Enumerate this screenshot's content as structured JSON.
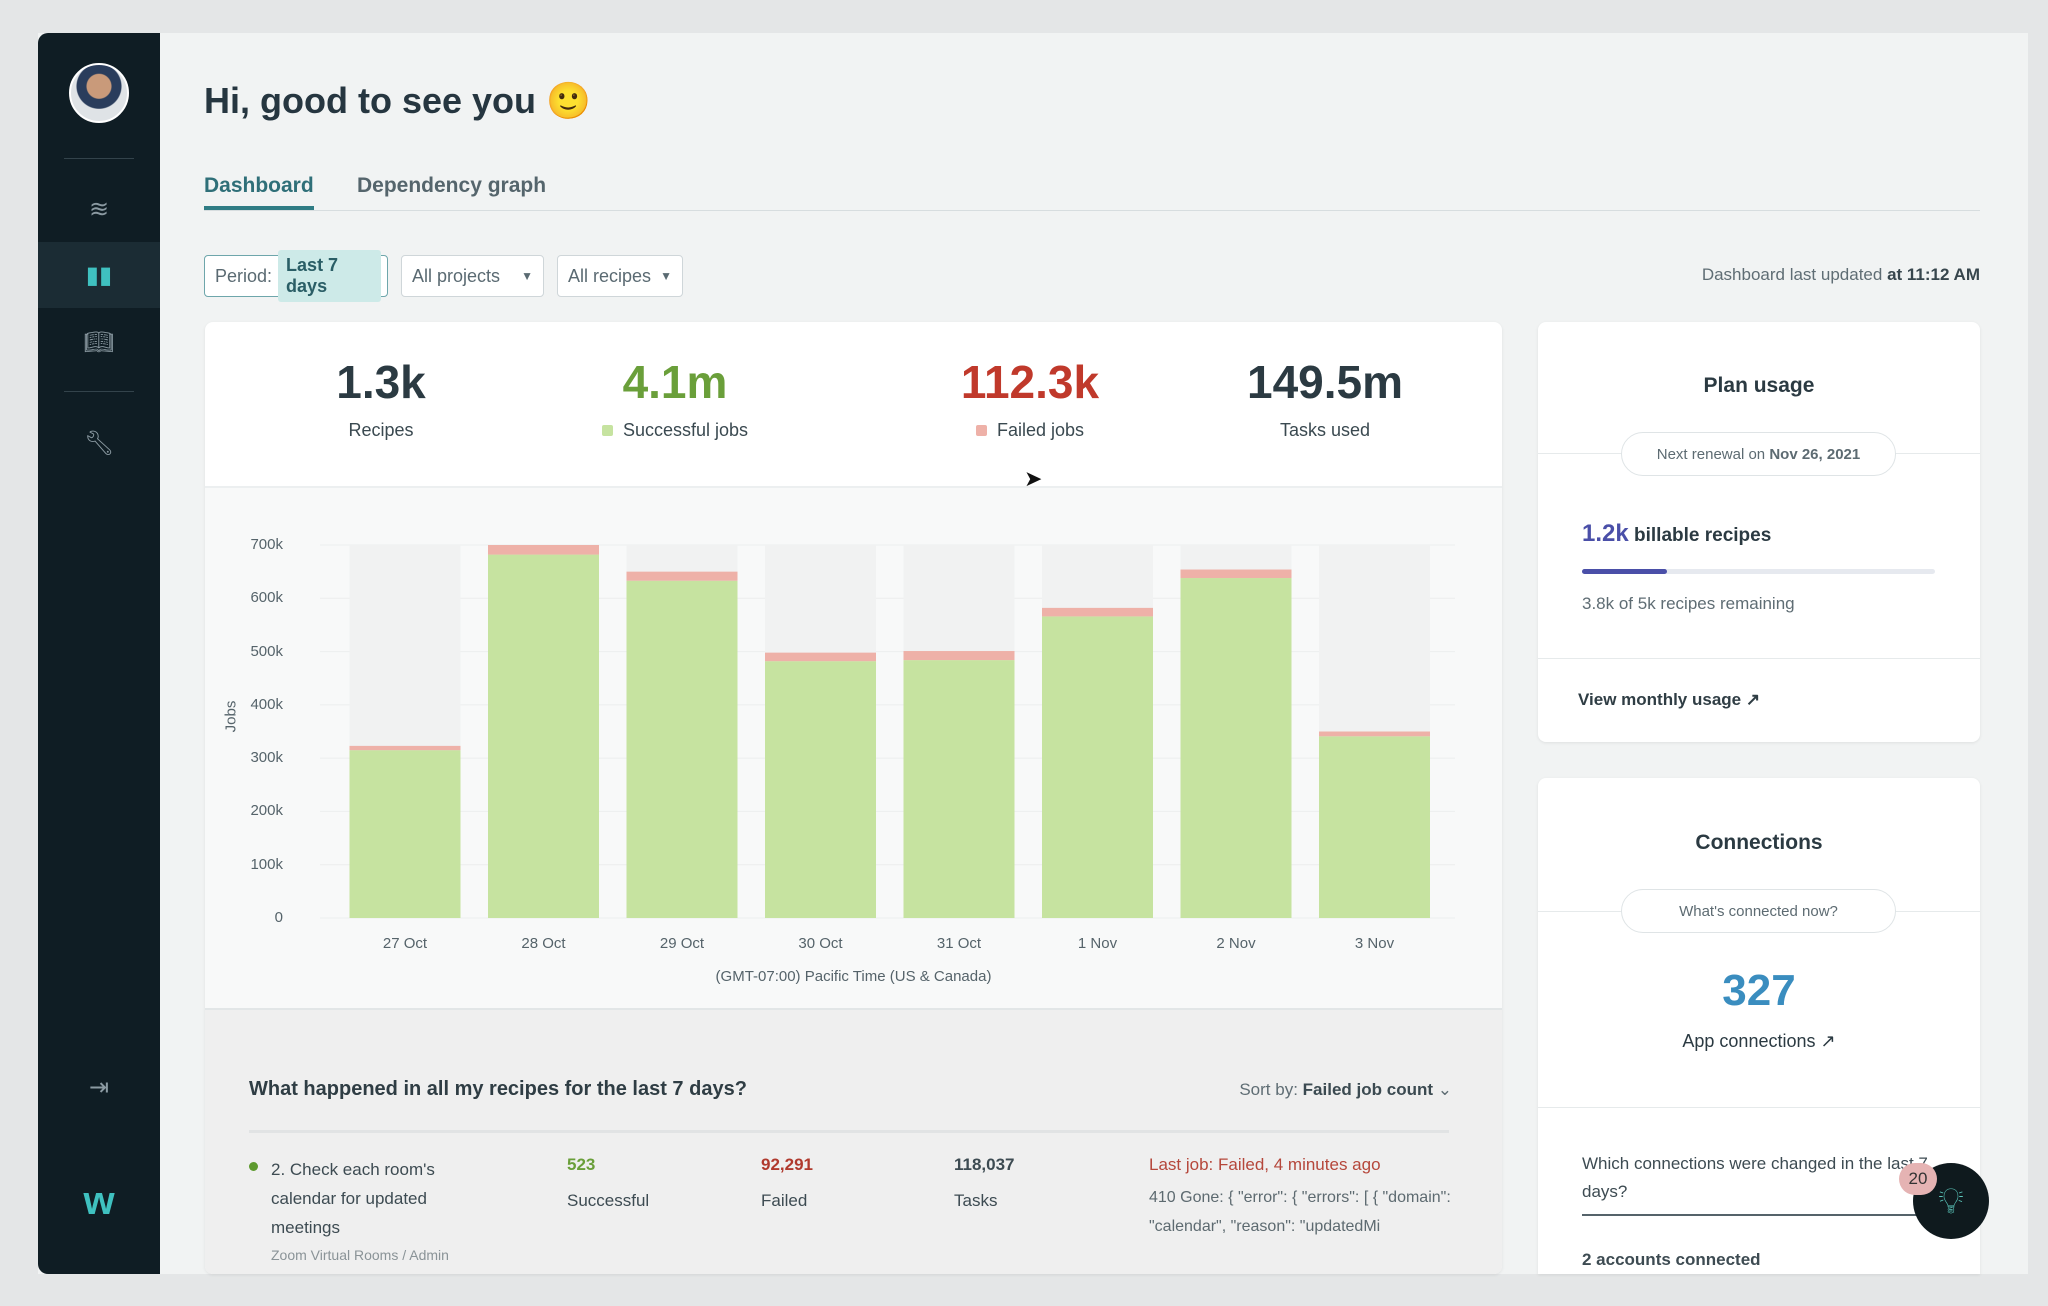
{
  "header": {
    "greeting": "Hi, good to see you",
    "emoji": "🙂"
  },
  "tabs": [
    {
      "label": "Dashboard",
      "active": true
    },
    {
      "label": "Dependency graph",
      "active": false
    }
  ],
  "filters": {
    "period_label": "Period:",
    "period_value": "Last 7 days",
    "projects": "All projects",
    "recipes": "All recipes"
  },
  "last_updated": {
    "prefix": "Dashboard last updated",
    "time": "at 11:12 AM"
  },
  "stats": [
    {
      "value": "1.3k",
      "label": "Recipes",
      "color": "#2b3a42"
    },
    {
      "value": "4.1m",
      "label": "Successful jobs",
      "color": "#6a9f3a"
    },
    {
      "value": "112.3k",
      "label": "Failed jobs",
      "color": "#c0392b"
    },
    {
      "value": "149.5m",
      "label": "Tasks used",
      "color": "#2b3a42"
    }
  ],
  "colors": {
    "success": "#c6e3a0",
    "failed": "#eeb1a8",
    "accent": "#2f7c84",
    "connections": "#3a8dbf",
    "sidebar": "#0f1d24"
  },
  "chart_data": {
    "type": "bar",
    "stacked": true,
    "categories": [
      "27 Oct",
      "28 Oct",
      "29 Oct",
      "30 Oct",
      "31 Oct",
      "1 Nov",
      "2 Nov",
      "3 Nov"
    ],
    "series": [
      {
        "name": "Successful jobs",
        "values": [
          315000,
          682000,
          633000,
          482000,
          484000,
          566000,
          638000,
          341000
        ]
      },
      {
        "name": "Failed jobs",
        "values": [
          8000,
          18000,
          17000,
          16000,
          17000,
          16000,
          16000,
          9000
        ]
      }
    ],
    "ylabel": "Jobs",
    "xlabel": "(GMT-07:00) Pacific Time (US & Canada)",
    "ylim": [
      0,
      700000
    ],
    "yticks": [
      "0",
      "100k",
      "200k",
      "300k",
      "400k",
      "500k",
      "600k",
      "700k"
    ],
    "grid": true
  },
  "recipes_section": {
    "title": "What happened in all my recipes for the last 7 days?",
    "sort_label": "Sort by:",
    "sort_value": "Failed job count",
    "rows": [
      {
        "name": "2. Check each room's calendar for updated meetings",
        "successful": "523",
        "successful_label": "Successful",
        "failed": "92,291",
        "failed_label": "Failed",
        "tasks": "118,037",
        "tasks_label": "Tasks",
        "last_job": "Last job: Failed, 4 minutes ago",
        "error": "410 Gone: { \"error\": { \"errors\": [ { \"domain\": \"calendar\", \"reason\": \"updatedMi",
        "folder": "Zoom Virtual Rooms / Admin"
      }
    ]
  },
  "plan": {
    "title": "Plan usage",
    "renewal_prefix": "Next renewal on",
    "renewal_date": "Nov 26, 2021",
    "billable_value": "1.2k",
    "billable_label": "billable recipes",
    "usage_fraction": 0.24,
    "remaining": "3.8k of 5k recipes remaining",
    "link": "View monthly usage"
  },
  "connections": {
    "title": "Connections",
    "pill": "What's connected now?",
    "count": "327",
    "count_label": "App connections",
    "question": "Which connections were changed in the last 7 days?",
    "accounts": "2 accounts connected"
  },
  "help": {
    "badge": "20"
  }
}
